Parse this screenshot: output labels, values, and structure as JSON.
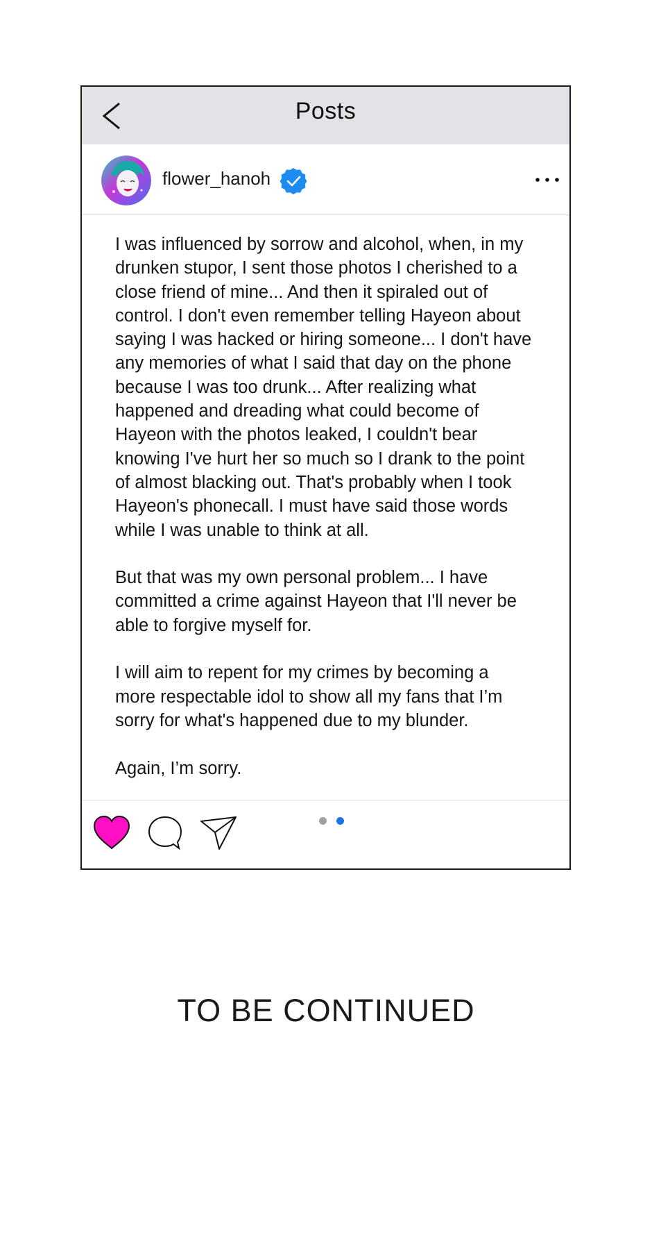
{
  "header": {
    "title": "Posts",
    "back_icon": "chevron-left-icon"
  },
  "post": {
    "username": "flower_hanoh",
    "verified_icon": "verified-badge-icon",
    "more_icon": "more-horizontal-icon",
    "paragraphs": [
      "I was influenced by sorrow and alcohol, when, in my\ndrunken stupor, I sent those photos I cherished to a\nclose friend of mine... And then it spiraled out of\ncontrol. I don't even remember telling Hayeon about\nsaying I was hacked or hiring someone... I don't have\nany memories of what I said that day on the phone\nbecause I was too drunk... After realizing what\nhappened and dreading what could become of\nHayeon with the photos leaked, I couldn't bear\nknowing I've hurt her so much so I drank to the point\nof almost blacking out. That's probably when I took\nHayeon's phonecall. I must have said those words\nwhile I was unable to think at all.",
      "But that was my own personal problem... I have\ncommitted a crime against Hayeon that I'll never be\nable to forgive myself for.",
      "I will aim to repent for my crimes by becoming a\nmore respectable idol to show all my fans that I’m\nsorry for what's happened due to my blunder.",
      "Again, I’m sorry."
    ]
  },
  "actions": {
    "like_icon": "heart-icon",
    "comment_icon": "comment-bubble-icon",
    "share_icon": "paper-plane-icon",
    "carousel": {
      "total": 2,
      "active_index": 2
    }
  },
  "colors": {
    "topbar_bg": "#e3e3e7",
    "like_heart": "#ff10c4",
    "verified_badge": "#1d8bf0",
    "carousel_active": "#1a73e8",
    "carousel_inactive": "#a0a0a0"
  },
  "footer": {
    "text": "TO BE CONTINUED"
  }
}
